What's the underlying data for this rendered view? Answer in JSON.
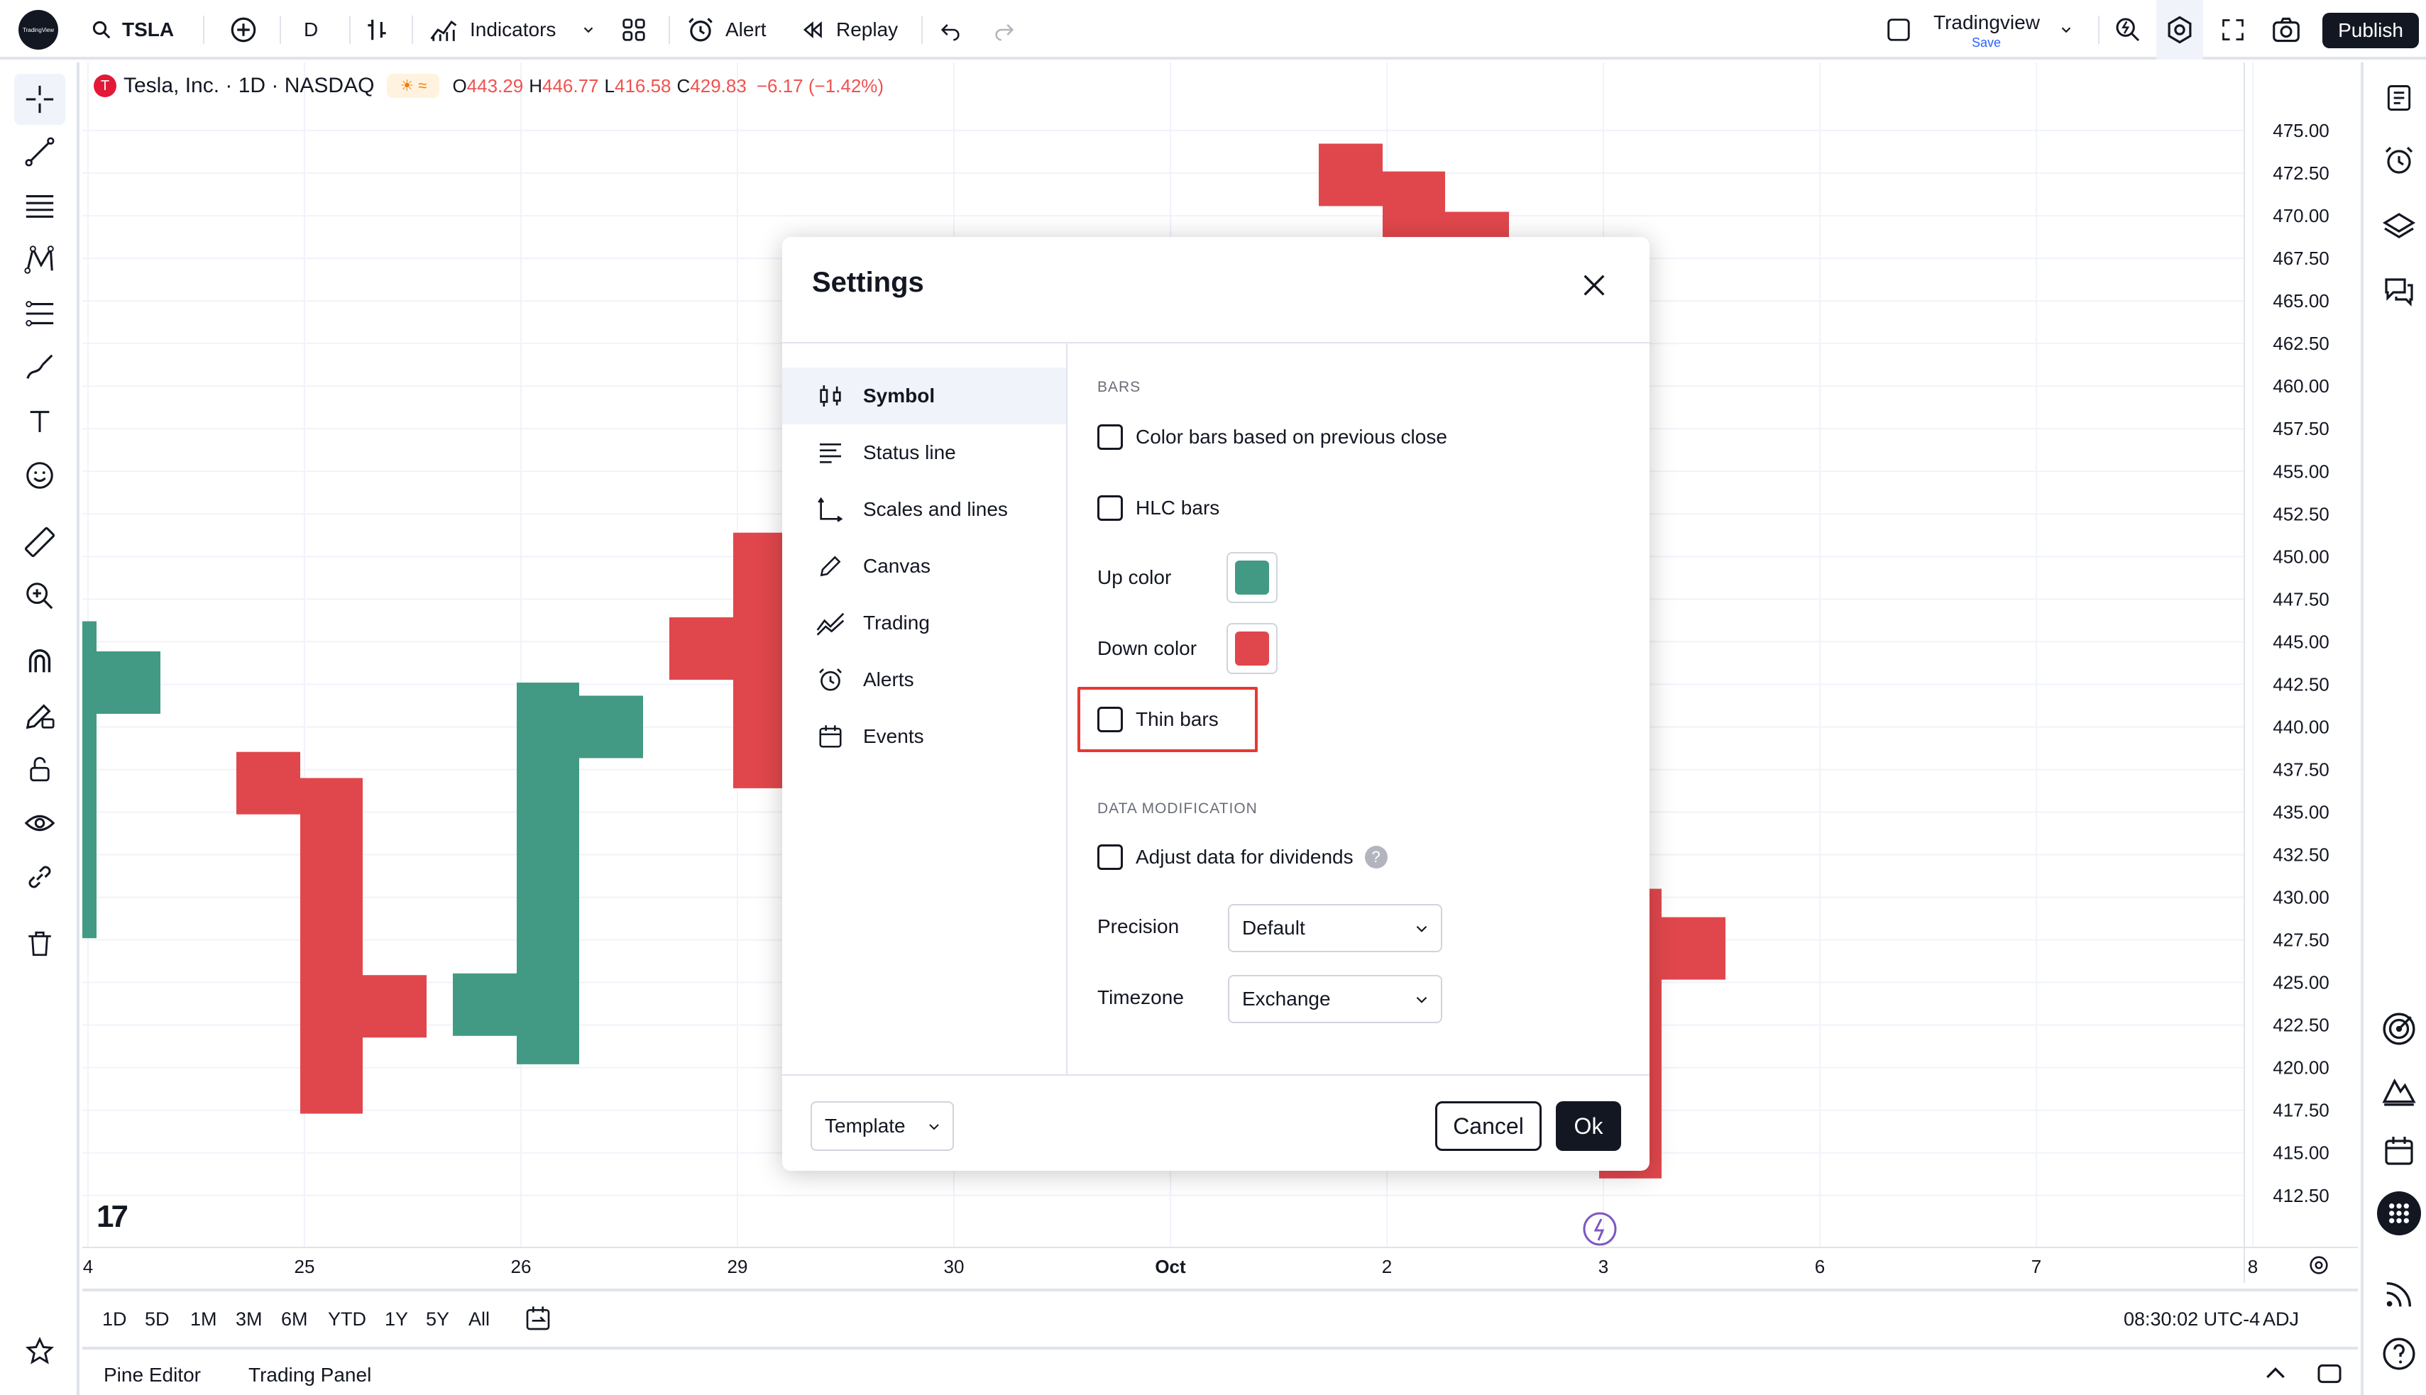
{
  "toolbar": {
    "logo_text": "TradingView",
    "symbol": "TSLA",
    "interval": "D",
    "indicators_label": "Indicators",
    "alert_label": "Alert",
    "replay_label": "Replay",
    "layout_name": "Tradingview",
    "layout_save": "Save",
    "publish_label": "Publish"
  },
  "legend": {
    "logo_letter": "T",
    "title": "Tesla, Inc. · 1D · NASDAQ",
    "badge": "☀ ≈",
    "o_label": "O",
    "o": "443.29",
    "h_label": "H",
    "h": "446.77",
    "l_label": "L",
    "l": "416.58",
    "c_label": "C",
    "c": "429.83",
    "change": "−6.17 (−1.42%)"
  },
  "chart_data": {
    "type": "bar",
    "subtype": "ohlc-bars",
    "y_ticks": [
      "475.00",
      "472.50",
      "470.00",
      "467.50",
      "465.00",
      "462.50",
      "460.00",
      "457.50",
      "455.00",
      "452.50",
      "450.00",
      "447.50",
      "445.00",
      "442.50",
      "440.00",
      "437.50",
      "435.00",
      "432.50",
      "430.00",
      "427.50",
      "425.00",
      "422.50",
      "420.00",
      "417.50",
      "415.00",
      "412.50"
    ],
    "x_ticks": [
      "4",
      "25",
      "26",
      "29",
      "30",
      "Oct",
      "2",
      "3",
      "6",
      "7",
      "8"
    ],
    "ylim": [
      410.7,
      476.5
    ],
    "up_color": "#429a84",
    "down_color": "#e0474c",
    "bars": [
      {
        "date": "Sep 24",
        "open": 442.1,
        "high": 446.2,
        "low": 427.6,
        "close": 442.6
      },
      {
        "date": "Sep 25",
        "open": 436.7,
        "high": 437.0,
        "low": 417.3,
        "close": 423.6
      },
      {
        "date": "Sep 26",
        "open": 423.7,
        "high": 442.6,
        "low": 420.2,
        "close": 440.0
      },
      {
        "date": "Sep 29",
        "open": 444.6,
        "high": 451.4,
        "low": 436.4,
        "close": 442.8
      },
      {
        "date": "Oct 2",
        "open": 472.4,
        "high": 472.6,
        "low": 467.9,
        "close": 468.4
      },
      {
        "date": "Oct 3",
        "open": 429.83,
        "high": 430.5,
        "low": 413.5,
        "close": 427.0
      }
    ]
  },
  "watermark": "17",
  "ranges": [
    "1D",
    "5D",
    "1M",
    "3M",
    "6M",
    "YTD",
    "1Y",
    "5Y",
    "All"
  ],
  "clock": "08:30:02 UTC-4",
  "adj": "ADJ",
  "panels": {
    "pine": "Pine Editor",
    "trading": "Trading Panel"
  },
  "dialog": {
    "title": "Settings",
    "nav": [
      "Symbol",
      "Status line",
      "Scales and lines",
      "Canvas",
      "Trading",
      "Alerts",
      "Events"
    ],
    "bars_section": "BARS",
    "color_bars": "Color bars based on previous close",
    "hlc_bars": "HLC bars",
    "up_color_label": "Up color",
    "down_color_label": "Down color",
    "thin_bars": "Thin bars",
    "data_mod_section": "DATA MODIFICATION",
    "adjust_dividends": "Adjust data for dividends",
    "help_glyph": "?",
    "precision_label": "Precision",
    "precision_value": "Default",
    "timezone_label": "Timezone",
    "timezone_value": "Exchange",
    "template_label": "Template",
    "cancel_label": "Cancel",
    "ok_label": "Ok"
  },
  "colors": {
    "highlight": "#e53935",
    "accent": "#2962ff",
    "dark": "#131722"
  }
}
